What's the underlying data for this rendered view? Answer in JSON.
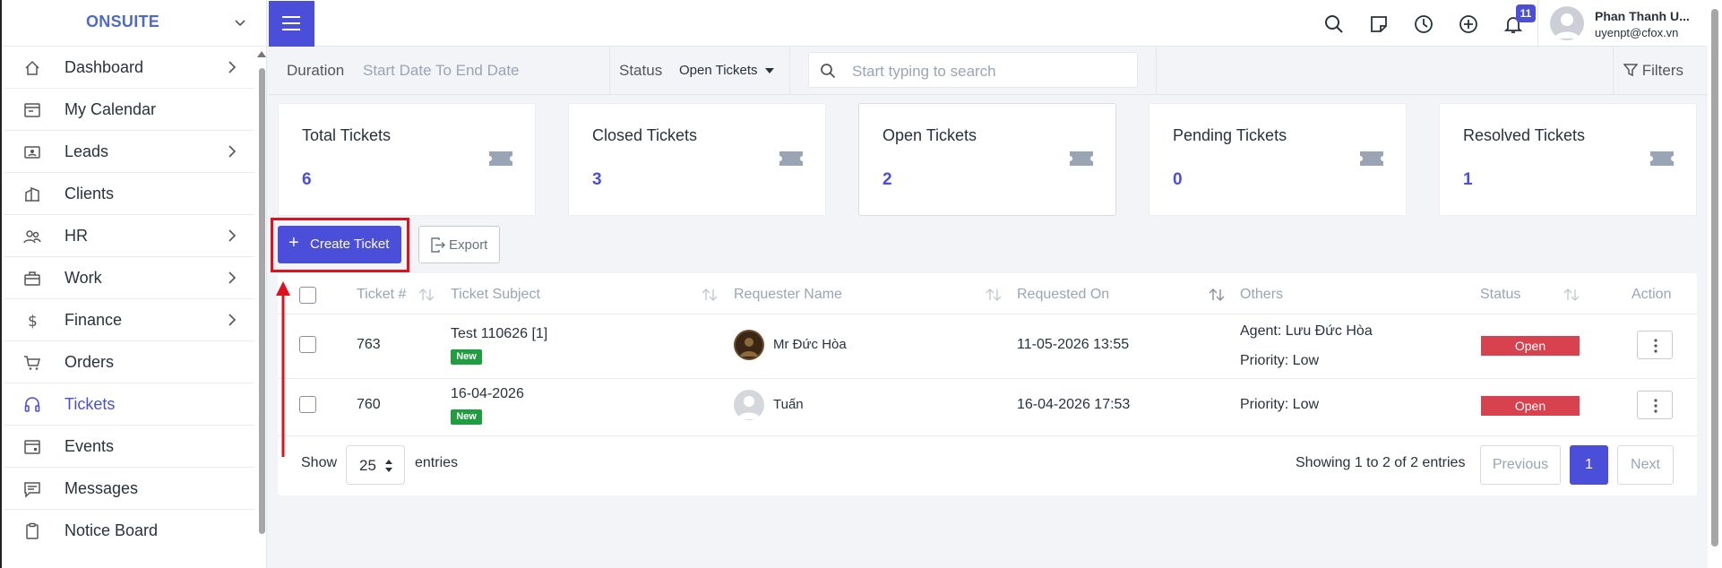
{
  "brand": {
    "name": "ONSUITE"
  },
  "sidebar": {
    "items": [
      {
        "label": "Dashboard",
        "icon": "home-icon",
        "has_arrow": true
      },
      {
        "label": "My Calendar",
        "icon": "calendar-icon",
        "has_arrow": false
      },
      {
        "label": "Leads",
        "icon": "id-card-icon",
        "has_arrow": true
      },
      {
        "label": "Clients",
        "icon": "building-icon",
        "has_arrow": false
      },
      {
        "label": "HR",
        "icon": "people-icon",
        "has_arrow": true
      },
      {
        "label": "Work",
        "icon": "briefcase-icon",
        "has_arrow": true
      },
      {
        "label": "Finance",
        "icon": "dollar-icon",
        "has_arrow": true
      },
      {
        "label": "Orders",
        "icon": "cart-icon",
        "has_arrow": false
      },
      {
        "label": "Tickets",
        "icon": "headset-icon",
        "has_arrow": false,
        "active": true
      },
      {
        "label": "Events",
        "icon": "calendar-event-icon",
        "has_arrow": false
      },
      {
        "label": "Messages",
        "icon": "message-icon",
        "has_arrow": false
      },
      {
        "label": "Notice Board",
        "icon": "clipboard-icon",
        "has_arrow": false
      }
    ]
  },
  "topbar": {
    "notification_count": "11",
    "user_name": "Phan Thanh U...",
    "user_email": "uyenpt@cfox.vn",
    "icons": [
      "search-icon",
      "sticky-note-icon",
      "clock-icon",
      "plus-circle-icon",
      "bell-icon"
    ]
  },
  "filters": {
    "duration_label": "Duration",
    "duration_value": "Start Date To End Date",
    "status_label": "Status",
    "status_value": "Open Tickets",
    "search_placeholder": "Start typing to search",
    "filters_label": "Filters"
  },
  "cards": [
    {
      "title": "Total Tickets",
      "value": "6"
    },
    {
      "title": "Closed Tickets",
      "value": "3"
    },
    {
      "title": "Open Tickets",
      "value": "2"
    },
    {
      "title": "Pending Tickets",
      "value": "0"
    },
    {
      "title": "Resolved Tickets",
      "value": "1"
    }
  ],
  "actions": {
    "create_label": "Create Ticket",
    "export_label": "Export"
  },
  "table": {
    "headers": [
      "Ticket #",
      "Ticket Subject",
      "Requester Name",
      "Requested On",
      "Others",
      "Status",
      "Action"
    ],
    "rows": [
      {
        "id": "763",
        "subject": "Test 110626 [1]",
        "badge": "New",
        "requester": "Mr Đức Hòa",
        "requested_on": "11-05-2026 13:55",
        "agent": "Agent: Lưu Đức Hòa",
        "priority": "Priority: Low",
        "status": "Open"
      },
      {
        "id": "760",
        "subject": "16-04-2026",
        "badge": "New",
        "requester": "Tuấn",
        "requested_on": "16-04-2026 17:53",
        "agent": "",
        "priority": "Priority: Low",
        "status": "Open"
      }
    ]
  },
  "footer": {
    "show_label": "Show",
    "page_size": "25",
    "entries_label": "entries",
    "showing_text": "Showing 1 to 2 of 2 entries",
    "prev_label": "Previous",
    "current_page": "1",
    "next_label": "Next"
  },
  "colors": {
    "accent": "#4b4ed9",
    "danger": "#d8424e",
    "success": "#1e9e3e",
    "highlight": "#e0101c"
  }
}
